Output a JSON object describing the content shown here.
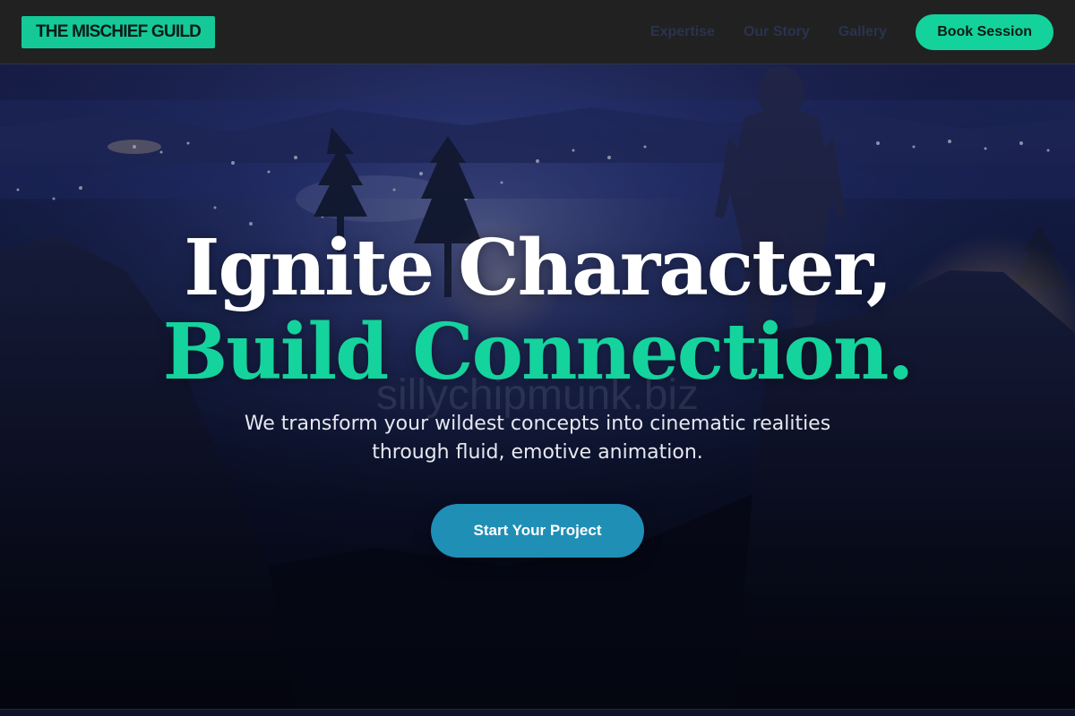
{
  "header": {
    "logo_text": "THE MISCHIEF GUILD",
    "nav": [
      {
        "label": "Expertise"
      },
      {
        "label": "Our Story"
      },
      {
        "label": "Gallery"
      }
    ],
    "cta_label": "Book Session"
  },
  "hero": {
    "headline_line1": "Ignite Character,",
    "headline_line2": "Build Connection.",
    "watermark": "sillychipmunk.biz",
    "subtitle": "We transform your wildest concepts into cinematic realities through fluid, emotive animation.",
    "cta_label": "Start Your Project"
  },
  "colors": {
    "accent": "#14d29c",
    "header_bg": "#212121",
    "cta_blue": "#1f8fb6",
    "headline_white": "#ffffff"
  }
}
